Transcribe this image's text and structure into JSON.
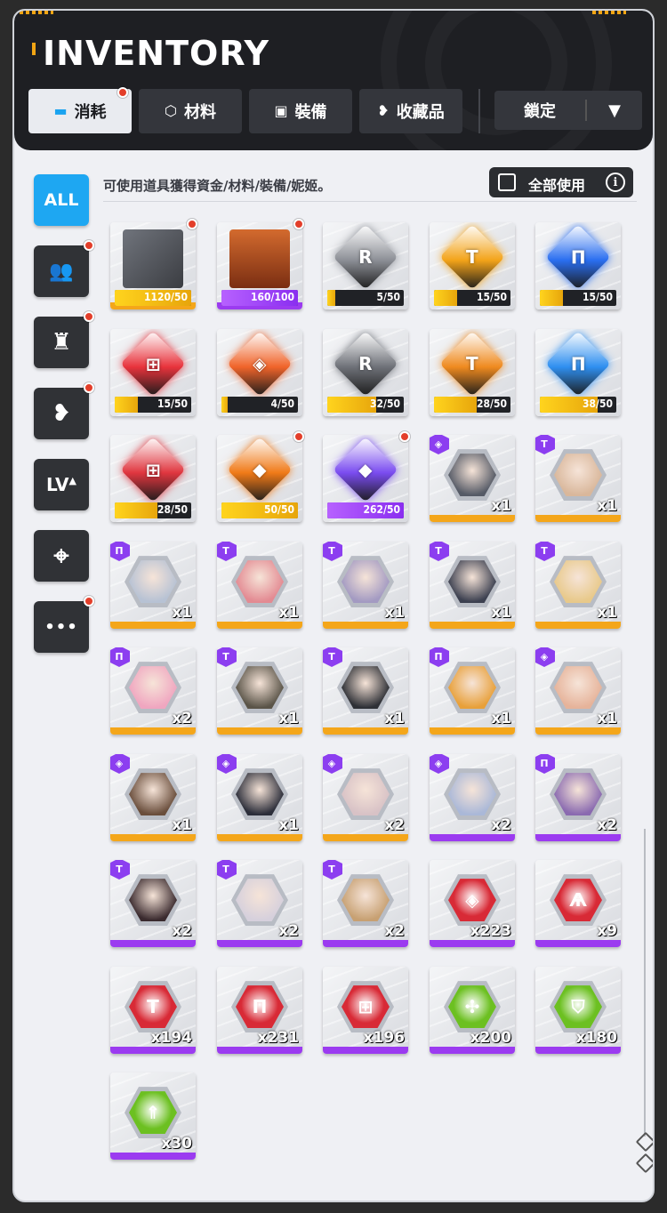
{
  "header": {
    "title": "INVENTORY"
  },
  "tabs": [
    {
      "label": "消耗",
      "icon": "ticket-icon",
      "active": true,
      "badge": true
    },
    {
      "label": "材料",
      "icon": "hex-nut-icon",
      "active": false,
      "badge": false
    },
    {
      "label": "裝備",
      "icon": "backpack-icon",
      "active": false,
      "badge": false
    },
    {
      "label": "收藏品",
      "icon": "heart-hand-icon",
      "active": false,
      "badge": false
    }
  ],
  "lock_dropdown": {
    "label": "鎖定",
    "arrow": "▼"
  },
  "sidebar": [
    {
      "label": "ALL",
      "icon": "all-filter",
      "active": true,
      "badge": false
    },
    {
      "label": "",
      "icon": "group-icon",
      "active": false,
      "badge": true
    },
    {
      "label": "",
      "icon": "armor-icon",
      "active": false,
      "badge": true
    },
    {
      "label": "",
      "icon": "heart-hand-icon",
      "active": false,
      "badge": true
    },
    {
      "label": "LV",
      "icon": "level-up-icon",
      "active": false,
      "badge": false
    },
    {
      "label": "",
      "icon": "crosshair-icon",
      "active": false,
      "badge": false
    },
    {
      "label": "•••",
      "icon": "more-icon",
      "active": false,
      "badge": true
    }
  ],
  "hint": "可使用道具獲得資金/材料/裝備/妮姬。",
  "use_all": {
    "label": "全部使用",
    "info": "i"
  },
  "colors": {
    "accent": "#1ea7f2",
    "gold": "#f4a61a",
    "purple": "#9b3bf0",
    "badge": "#e33e2a"
  },
  "items": [
    {
      "kind": "bar",
      "qty": "1120/50",
      "fill": 1.0,
      "visual": "dark-card",
      "color": "#53565d",
      "rarity": "gold",
      "badge": true
    },
    {
      "kind": "bar",
      "qty": "160/100",
      "fill": 1.0,
      "visual": "chest",
      "color": "#9a4a22",
      "rarity": "purple",
      "badge": true
    },
    {
      "kind": "bar",
      "qty": "5/50",
      "fill": 0.1,
      "visual": "gem",
      "glyph": "R",
      "color": "#8c8f96",
      "badge": false
    },
    {
      "kind": "bar",
      "qty": "15/50",
      "fill": 0.3,
      "visual": "gem",
      "glyph": "T",
      "color": "#f3a319",
      "badge": false
    },
    {
      "kind": "bar",
      "qty": "15/50",
      "fill": 0.3,
      "visual": "gem",
      "glyph": "Π",
      "color": "#2a6ef0",
      "badge": false
    },
    {
      "kind": "bar",
      "qty": "15/50",
      "fill": 0.3,
      "visual": "gem",
      "glyph": "⊞",
      "color": "#e8333c",
      "badge": false
    },
    {
      "kind": "bar",
      "qty": "4/50",
      "fill": 0.08,
      "visual": "gem",
      "glyph": "◈",
      "color": "#f0642a",
      "badge": false
    },
    {
      "kind": "bar",
      "qty": "32/50",
      "fill": 0.64,
      "visual": "gem",
      "glyph": "R",
      "color": "#6e7178",
      "badge": false
    },
    {
      "kind": "bar",
      "qty": "28/50",
      "fill": 0.56,
      "visual": "gem",
      "glyph": "T",
      "color": "#ef8a1f",
      "badge": false
    },
    {
      "kind": "bar",
      "qty": "38/50",
      "fill": 0.76,
      "visual": "gem",
      "glyph": "Π",
      "color": "#2f8ff0",
      "badge": false
    },
    {
      "kind": "bar",
      "qty": "28/50",
      "fill": 0.56,
      "visual": "gem",
      "glyph": "⊞",
      "color": "#e0363f",
      "badge": false
    },
    {
      "kind": "bar",
      "qty": "50/50",
      "fill": 1.0,
      "visual": "gem",
      "glyph": "◆",
      "color": "#f07a18",
      "badge": true
    },
    {
      "kind": "bar",
      "qty": "262/50",
      "fill": 1.0,
      "visual": "gem",
      "glyph": "◆",
      "color": "#7a4cf0",
      "bar_color": "purple",
      "badge": true
    },
    {
      "kind": "char",
      "qty": "x1",
      "tag": "◈",
      "color": "#555a66",
      "rarity": "gold"
    },
    {
      "kind": "char",
      "qty": "x1",
      "tag": "T",
      "color": "#d9b79b",
      "rarity": "gold"
    },
    {
      "kind": "char",
      "qty": "x1",
      "tag": "Π",
      "color": "#b7c2d4",
      "rarity": "gold"
    },
    {
      "kind": "char",
      "qty": "x1",
      "tag": "T",
      "color": "#e38a92",
      "rarity": "gold"
    },
    {
      "kind": "char",
      "qty": "x1",
      "tag": "T",
      "color": "#a39ac2",
      "rarity": "gold"
    },
    {
      "kind": "char",
      "qty": "x1",
      "tag": "T",
      "color": "#3c4050",
      "rarity": "gold"
    },
    {
      "kind": "char",
      "qty": "x1",
      "tag": "T",
      "color": "#e8c98a",
      "rarity": "gold"
    },
    {
      "kind": "char",
      "qty": "x2",
      "tag": "Π",
      "color": "#f0a6c0",
      "rarity": "gold"
    },
    {
      "kind": "char",
      "qty": "x1",
      "tag": "T",
      "color": "#5a5448",
      "rarity": "gold"
    },
    {
      "kind": "char",
      "qty": "x1",
      "tag": "T",
      "color": "#2e3036",
      "rarity": "gold"
    },
    {
      "kind": "char",
      "qty": "x1",
      "tag": "Π",
      "color": "#e8a03a",
      "rarity": "gold"
    },
    {
      "kind": "char",
      "qty": "x1",
      "tag": "◈",
      "color": "#e6b39a",
      "rarity": "gold"
    },
    {
      "kind": "char",
      "qty": "x1",
      "tag": "◈",
      "color": "#6a4e3c",
      "rarity": "gold"
    },
    {
      "kind": "char",
      "qty": "x1",
      "tag": "◈",
      "color": "#2c2e3a",
      "rarity": "gold"
    },
    {
      "kind": "char",
      "qty": "x2",
      "tag": "◈",
      "color": "#d8c2c6",
      "rarity": "gold"
    },
    {
      "kind": "char",
      "qty": "x2",
      "tag": "◈",
      "color": "#aab8d8",
      "rarity": "purple"
    },
    {
      "kind": "char",
      "qty": "x2",
      "tag": "Π",
      "color": "#8a6ab0",
      "rarity": "purple"
    },
    {
      "kind": "char",
      "qty": "x2",
      "tag": "T",
      "color": "#3a2a2e",
      "rarity": "purple"
    },
    {
      "kind": "char",
      "qty": "x2",
      "tag": "T",
      "color": "#d6d0dc",
      "rarity": "purple"
    },
    {
      "kind": "char",
      "qty": "x2",
      "tag": "T",
      "color": "#c7a072",
      "rarity": "purple"
    },
    {
      "kind": "emblem",
      "qty": "x223",
      "glyph": "◈",
      "color": "#d82a36",
      "rarity": "purple"
    },
    {
      "kind": "emblem",
      "qty": "x9",
      "glyph": "Ѧ",
      "color": "#d82a36",
      "rarity": "purple"
    },
    {
      "kind": "emblem",
      "qty": "x194",
      "glyph": "T",
      "color": "#d82a36",
      "rarity": "purple"
    },
    {
      "kind": "emblem",
      "qty": "x231",
      "glyph": "Π",
      "color": "#d82a36",
      "rarity": "purple"
    },
    {
      "kind": "emblem",
      "qty": "x196",
      "glyph": "⊞",
      "color": "#d82a36",
      "rarity": "purple"
    },
    {
      "kind": "emblem",
      "qty": "x200",
      "glyph": "✣",
      "color": "#6cc021",
      "rarity": "purple"
    },
    {
      "kind": "emblem",
      "qty": "x180",
      "glyph": "⛉",
      "color": "#6cc021",
      "rarity": "purple"
    },
    {
      "kind": "emblem",
      "qty": "x30",
      "glyph": "⇑",
      "color": "#6cc021",
      "rarity": "purple"
    }
  ]
}
